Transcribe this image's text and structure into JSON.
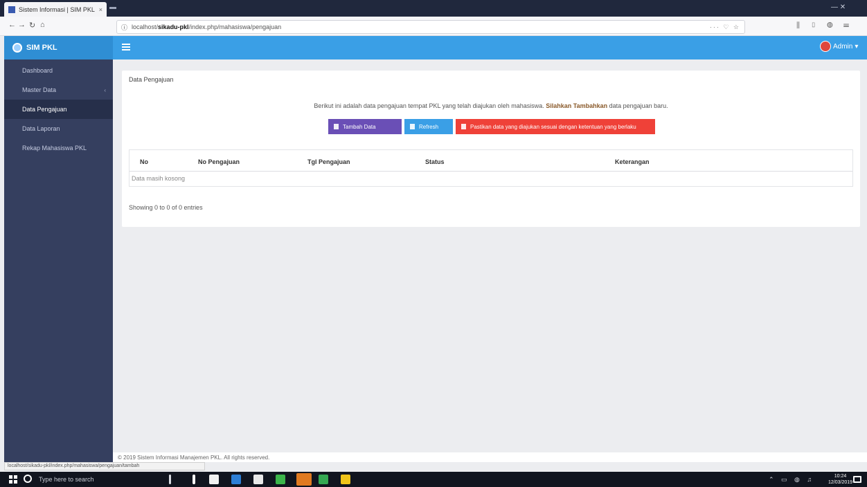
{
  "browser": {
    "tab_title": "Sistem Informasi | SIM PKL",
    "tab_close": "×",
    "url_prefix": "localhost/",
    "url_bold": "sikadu-pkl",
    "url_rest": "/index.php/mahasiswa/pengajuan",
    "page_actions": "··· ♡ ☆",
    "nav_back": "←",
    "nav_forward": "→",
    "nav_reload": "↻",
    "nav_home": "⌂",
    "tool_icons": "⫼ ▯ ◍ ☰",
    "window_controls": "—   ✕"
  },
  "header": {
    "brand": "SIM PKL",
    "user_label": "Admin"
  },
  "sidebar": {
    "items": [
      {
        "label": "Dashboard",
        "active": false
      },
      {
        "label": "Master Data",
        "active": false,
        "has_caret": true
      },
      {
        "label": "Data Pengajuan",
        "active": true
      },
      {
        "label": "Data Laporan",
        "active": false
      },
      {
        "label": "Rekap Mahasiswa PKL",
        "active": false
      }
    ]
  },
  "card": {
    "title": "Data Pengajuan",
    "info_prefix": "Berikut ini adalah data pengajuan tempat PKL yang telah diajukan oleh mahasiswa. ",
    "info_bold": "Silahkan Tambahkan",
    "info_suffix": " data pengajuan baru.",
    "buttons": {
      "add": "Tambah Data",
      "refresh": "Refresh",
      "warning": "Pastikan data yang diajukan sesuai dengan ketentuan yang berlaku"
    },
    "table": {
      "columns": [
        "No",
        "No Pengajuan",
        "Tgl Pengajuan",
        "Status",
        "Keterangan"
      ],
      "empty_message": "Data masih kosong",
      "info": "Showing 0 to 0 of 0 entries"
    }
  },
  "footer": {
    "text": "© 2019 Sistem Informasi Manajemen PKL. All rights reserved."
  },
  "statusbar": {
    "text": "localhost/sikadu-pkl/index.php/mahasiswa/pengajuan/tambah"
  },
  "taskbar": {
    "search_text": "Type here to search",
    "tray": "⌃ ▭ ◍ ♫",
    "clock_time": "10:24",
    "clock_date": "12/03/2019"
  },
  "colors": {
    "header": "#3a9fe6",
    "sidebar": "#353f5f",
    "button_purple": "#6a4fb6",
    "button_blue": "#3a9fe6",
    "button_red": "#ef4138"
  }
}
